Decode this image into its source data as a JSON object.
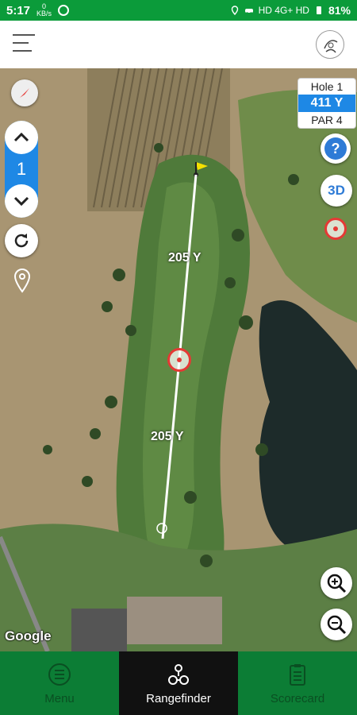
{
  "status_bar": {
    "time": "5:17",
    "data_rate": "0",
    "data_unit": "KB/s",
    "network": "HD 4G+ HD",
    "battery": "81%"
  },
  "header": {
    "menu_icon": "hamburger-icon",
    "logo_icon": "club-logo-icon"
  },
  "map": {
    "hole_number": "1",
    "hole_card": {
      "hole": "Hole 1",
      "yardage": "411 Y",
      "par": "PAR 4"
    },
    "distance_to_target": "205 Y",
    "distance_from_tee": "205 Y",
    "help_label": "?",
    "view_3d_label": "3D",
    "attribution": "Google"
  },
  "nav": [
    {
      "label": "Menu",
      "icon": "menu-list-icon"
    },
    {
      "label": "Rangefinder",
      "icon": "rangefinder-icon"
    },
    {
      "label": "Scorecard",
      "icon": "scorecard-icon"
    }
  ],
  "colors": {
    "status_green": "#0b9b3a",
    "nav_green": "#0c7d35",
    "accent_blue": "#1e88e5",
    "target_red": "#e53935"
  }
}
